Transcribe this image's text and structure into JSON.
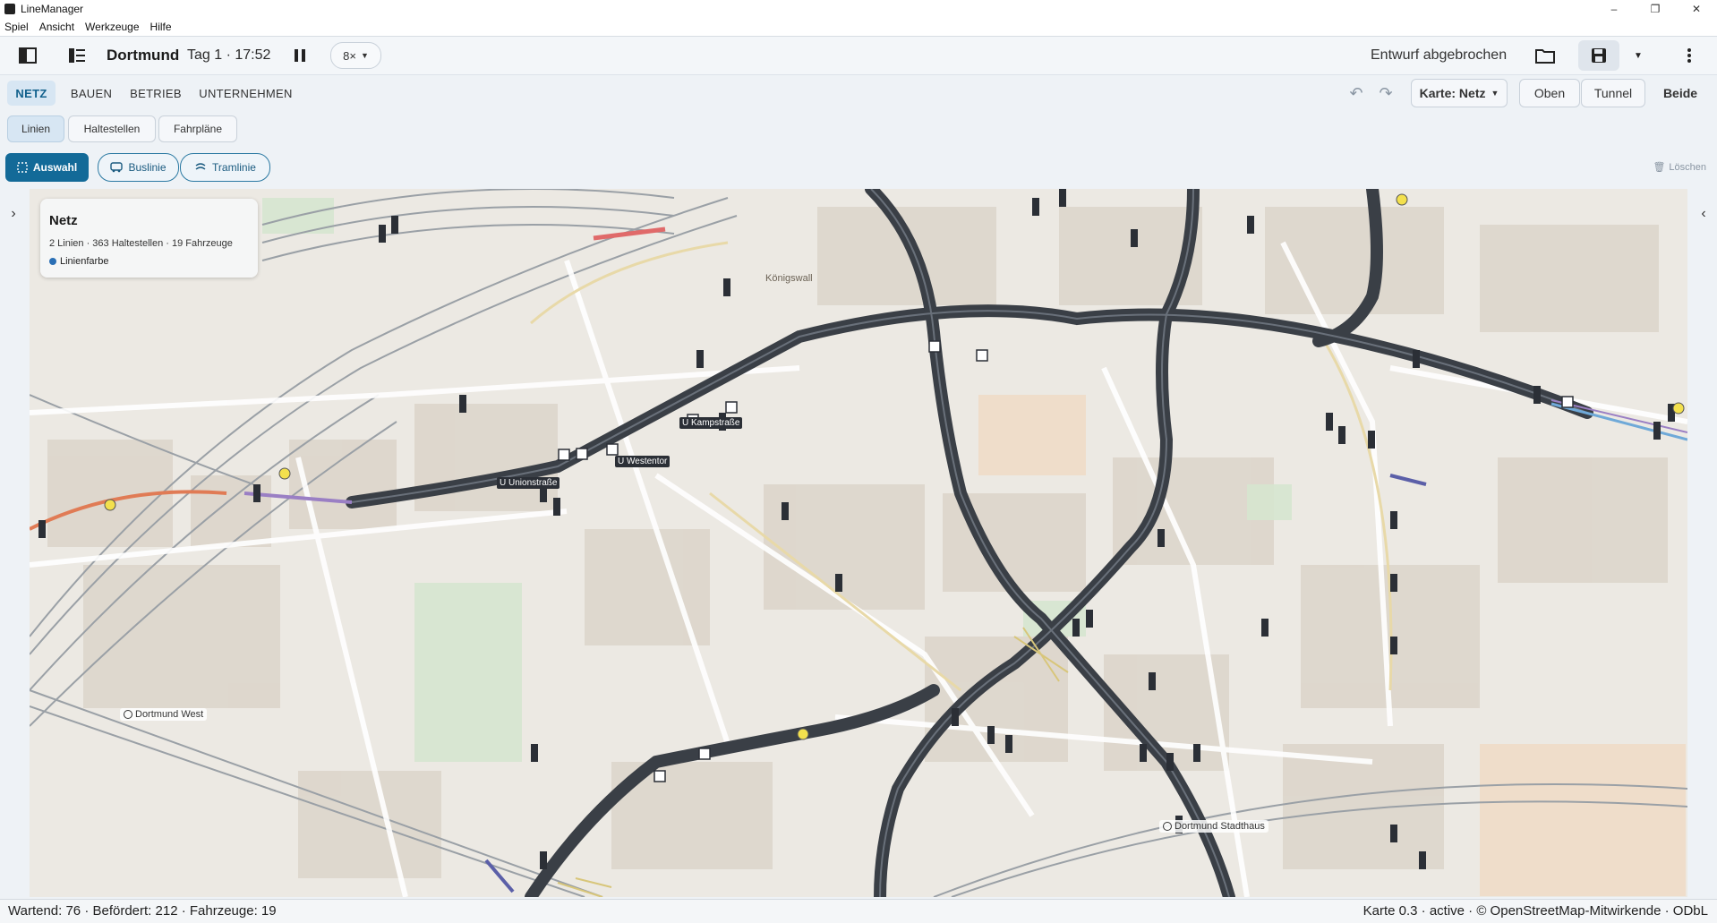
{
  "window": {
    "title": "LineManager",
    "controls": [
      "–",
      "❐",
      "✕"
    ]
  },
  "menu": [
    "Spiel",
    "Ansicht",
    "Werkzeuge",
    "Hilfe"
  ],
  "toolbar": {
    "city": "Dortmund",
    "day_time": "Tag 1 · 17:52",
    "speed": "8×",
    "status": "Entwurf abgebrochen"
  },
  "nav": {
    "tabs": [
      {
        "label": "NETZ",
        "active": true
      },
      {
        "label": "BAUEN",
        "active": false
      },
      {
        "label": "BETRIEB",
        "active": false
      },
      {
        "label": "UNTERNEHMEN",
        "active": false
      }
    ],
    "map_select": "Karte: Netz",
    "view_buttons": [
      {
        "label": "Oben",
        "active": false
      },
      {
        "label": "Tunnel",
        "active": false
      },
      {
        "label": "Beide",
        "active": true
      }
    ]
  },
  "subtabs": [
    {
      "label": "Linien",
      "active": true
    },
    {
      "label": "Haltestellen",
      "active": false
    },
    {
      "label": "Fahrpläne",
      "active": false
    }
  ],
  "tools": [
    {
      "label": "Auswahl",
      "active": true
    },
    {
      "label": "Buslinie",
      "active": false
    },
    {
      "label": "Tramlinie",
      "active": false
    }
  ],
  "delete_label": "Löschen",
  "infocard": {
    "title": "Netz",
    "summary": "2 Linien · 363 Haltestellen · 19 Fahrzeuge",
    "legend": "Linienfarbe",
    "legend_color": "#2a6fb5"
  },
  "map_labels": {
    "stations": [
      "Dortmund West",
      "Dortmund Stadthaus"
    ],
    "streets": [
      "Königswall"
    ],
    "stops": [
      "U Unionstraße",
      "U Westentor",
      "U Kampstraße"
    ]
  },
  "statusbar": {
    "left": "Wartend: 76 · Befördert: 212 · Fahrzeuge: 19",
    "right": "Karte 0.3 · active · © OpenStreetMap-Mitwirkende · ODbL"
  },
  "colors": {
    "accent": "#136a98",
    "road": "#3a3f46",
    "map_bg": "#ece9e3"
  }
}
